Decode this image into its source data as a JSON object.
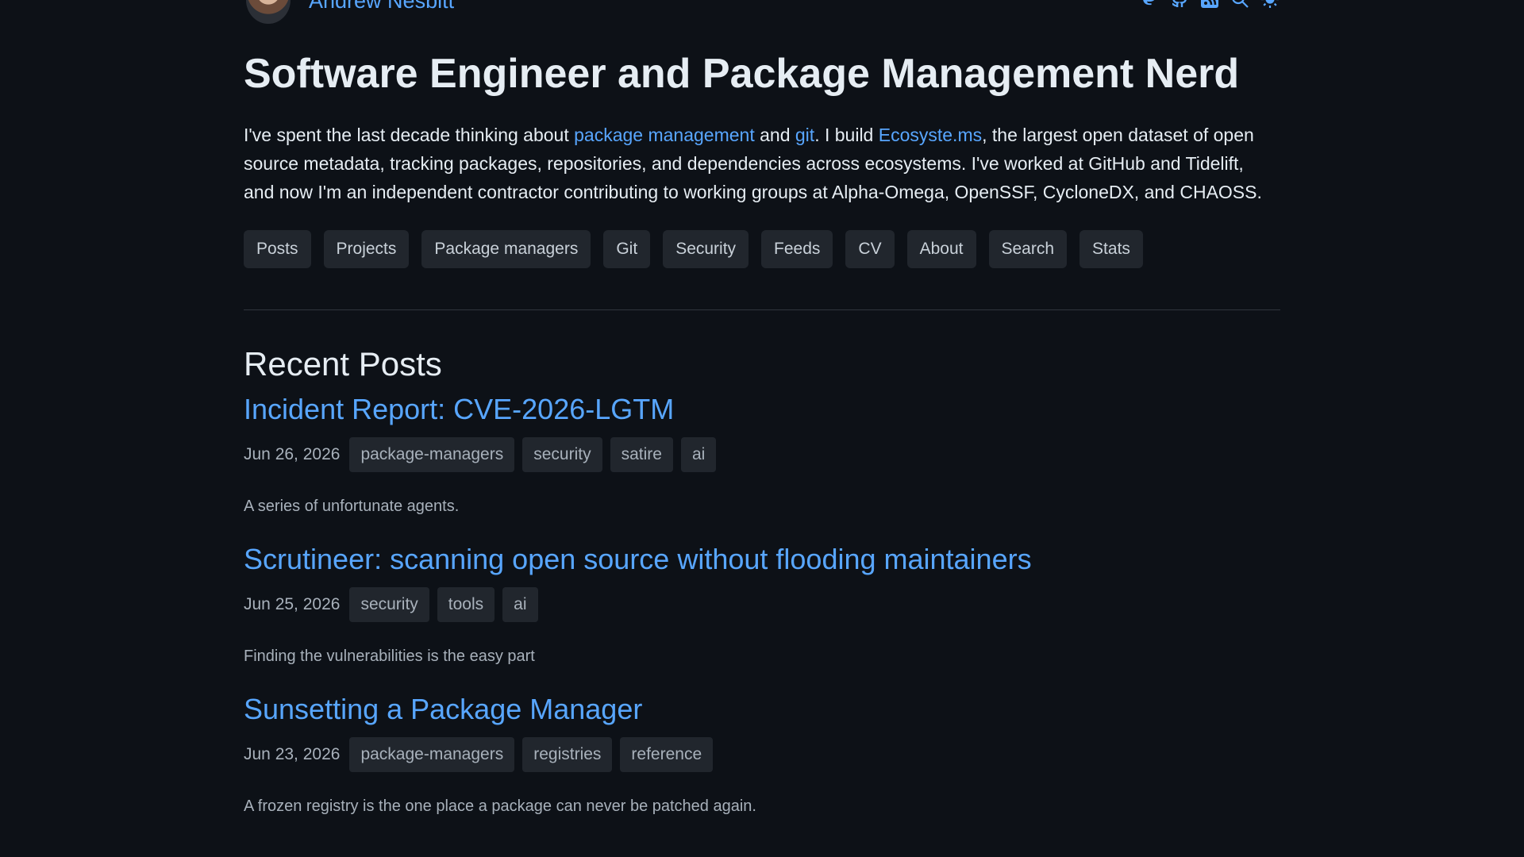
{
  "header": {
    "site_name": "Andrew Nesbitt",
    "icons": [
      "mastodon-icon",
      "github-icon",
      "rss-icon",
      "search-icon",
      "theme-toggle-icon"
    ]
  },
  "tagline": "Software Engineer and Package Management Nerd",
  "intro": {
    "t1": "I've spent the last decade thinking about ",
    "link1": "package management",
    "t2": " and ",
    "link2": "git",
    "t3": ". I build ",
    "link3": "Ecosyste.ms",
    "t4": ", the largest open dataset of open source metadata, tracking packages, repositories, and dependencies across ecosystems. I've worked at GitHub and Tidelift, and now I'm an independent contractor contributing to working groups at Alpha-Omega, OpenSSF, CycloneDX, and CHAOSS."
  },
  "nav": [
    "Posts",
    "Projects",
    "Package managers",
    "Git",
    "Security",
    "Feeds",
    "CV",
    "About",
    "Search",
    "Stats"
  ],
  "recent_posts_heading": "Recent Posts",
  "posts": [
    {
      "title": "Incident Report: CVE-2026-LGTM",
      "date": "Jun 26, 2026",
      "tags": [
        "package-managers",
        "security",
        "satire",
        "ai"
      ],
      "desc": "A series of unfortunate agents."
    },
    {
      "title": "Scrutineer: scanning open source without flooding maintainers",
      "date": "Jun 25, 2026",
      "tags": [
        "security",
        "tools",
        "ai"
      ],
      "desc": "Finding the vulnerabilities is the easy part"
    },
    {
      "title": "Sunsetting a Package Manager",
      "date": "Jun 23, 2026",
      "tags": [
        "package-managers",
        "registries",
        "reference"
      ],
      "desc": "A frozen registry is the one place a package can never be patched again."
    }
  ],
  "colors": {
    "background": "#0d1117",
    "link": "#58a6ff",
    "chip_bg": "#21262d",
    "text": "#e6edf3",
    "muted": "#a8b1bb"
  }
}
